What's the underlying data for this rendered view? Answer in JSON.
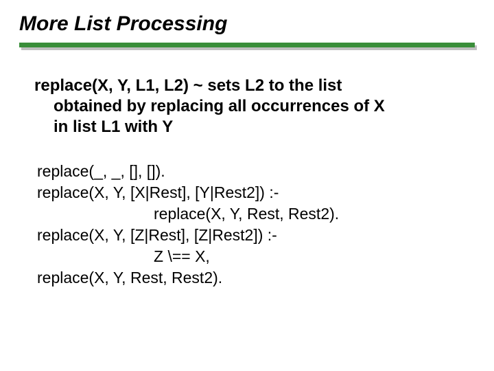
{
  "slide": {
    "title": "More List Processing",
    "desc": {
      "line1": "replace(X, Y, L1, L2) ~ sets L2 to the list",
      "line2": "obtained by replacing all occurrences of X",
      "line3": "in list L1 with Y"
    },
    "code": {
      "l1": "replace(_, _, [], []).",
      "l2": "replace(X, Y, [X|Rest], [Y|Rest2]) :-",
      "l3": "replace(X, Y, Rest, Rest2).",
      "l4": "replace(X, Y, [Z|Rest], [Z|Rest2]) :-",
      "l5": "Z \\== X,",
      "l6": "replace(X, Y, Rest, Rest2)."
    }
  }
}
